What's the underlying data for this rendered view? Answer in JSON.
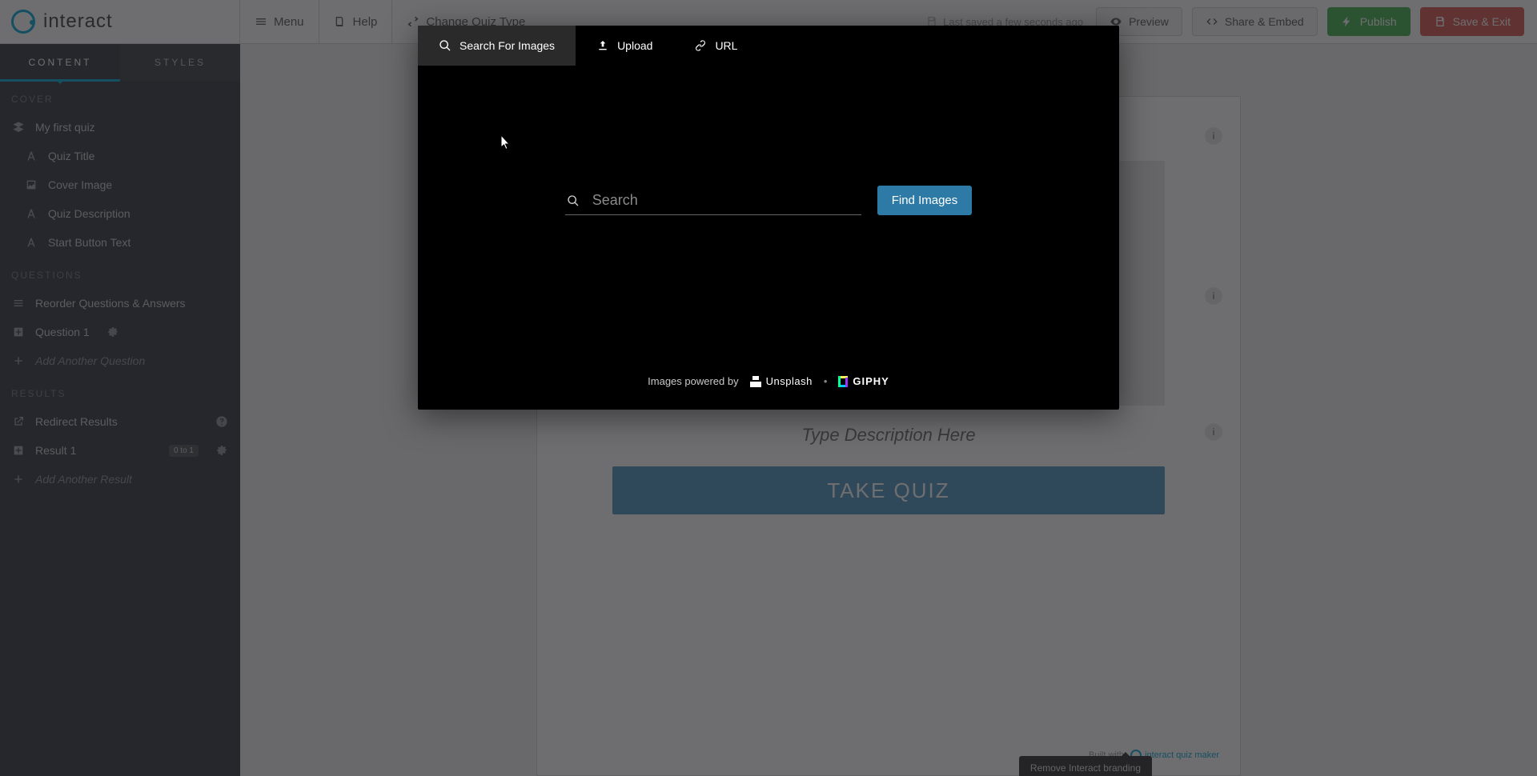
{
  "topbar": {
    "logo_text": "interact",
    "menu_label": "Menu",
    "help_label": "Help",
    "change_type_label": "Change Quiz Type",
    "save_status": "Last saved a few seconds ago",
    "preview_label": "Preview",
    "share_label": "Share & Embed",
    "publish_label": "Publish",
    "save_exit_label": "Save & Exit"
  },
  "sidebar": {
    "tabs": {
      "content": "CONTENT",
      "styles": "STYLES"
    },
    "cover": {
      "heading": "COVER",
      "quiz_name": "My first quiz",
      "items": {
        "title": "Quiz Title",
        "image": "Cover Image",
        "description": "Quiz Description",
        "start_button": "Start Button Text"
      }
    },
    "questions": {
      "heading": "QUESTIONS",
      "reorder": "Reorder Questions & Answers",
      "q1": "Question 1",
      "add": "Add Another Question"
    },
    "results": {
      "heading": "RESULTS",
      "redirect": "Redirect Results",
      "r1": "Result 1",
      "r1_badge": "0 to 1",
      "add": "Add Another Result"
    }
  },
  "editor": {
    "description_placeholder": "Type Description Here",
    "take_quiz_label": "TAKE QUIZ",
    "built_with_label": "Built with",
    "built_with_brand": "interact quiz maker",
    "branding_popover": "Remove Interact branding"
  },
  "modal": {
    "tabs": {
      "search": "Search For Images",
      "upload": "Upload",
      "url": "URL"
    },
    "search_placeholder": "Search",
    "find_button": "Find Images",
    "attribution_lead": "Images powered by",
    "unsplash": "Unsplash",
    "giphy": "GIPHY"
  }
}
